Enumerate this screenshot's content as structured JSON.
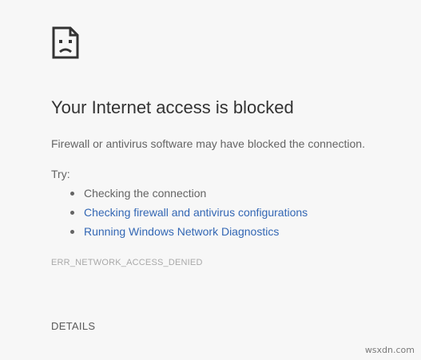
{
  "error_page": {
    "icon": "sad-document-icon",
    "title": "Your Internet access is blocked",
    "message": "Firewall or antivirus software may have blocked the connection.",
    "try_label": "Try:",
    "suggestions": [
      {
        "text": "Checking the connection",
        "is_link": false
      },
      {
        "text": "Checking firewall and antivirus configurations",
        "is_link": true
      },
      {
        "text": "Running Windows Network Diagnostics",
        "is_link": true
      }
    ],
    "error_code": "ERR_NETWORK_ACCESS_DENIED",
    "details_label": "DETAILS"
  },
  "watermark": "wsxdn.com",
  "colors": {
    "background": "#f7f7f7",
    "title": "#333333",
    "body_text": "#646464",
    "link": "#3367b4",
    "error_code": "#a9a9a9"
  }
}
